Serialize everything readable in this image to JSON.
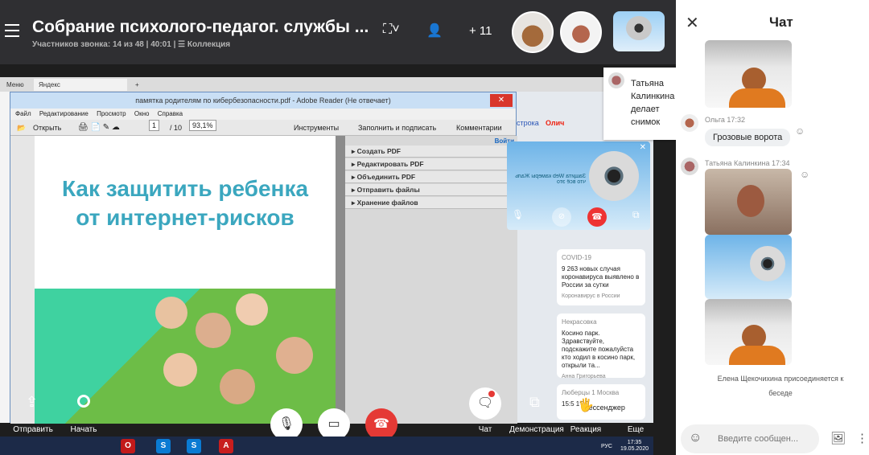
{
  "call": {
    "title": "Собрание психолого-педагог. службы ...",
    "subtitle": "Участников звонка: 14 из 48 | 40:01 | ☰ Коллекция",
    "extra_participants": "+ 11"
  },
  "browser": {
    "tabs": [
      {
        "label": "Меню"
      },
      {
        "label": "Яндекс"
      }
    ],
    "new_tab": "+"
  },
  "reader": {
    "title": "памятка родителям по кибербезопасности.pdf - Adobe Reader (Не отвечает)",
    "close": "✕",
    "menu": [
      "Файл",
      "Редактирование",
      "Просмотр",
      "Окно",
      "Справка"
    ],
    "toolbar": {
      "open": "Открыть",
      "page_current": "1",
      "page_total": "/ 10",
      "zoom": "93,1%",
      "tools": "Инструменты",
      "fill_sign": "Заполнить и подписать",
      "comments": "Комментарии"
    },
    "signin": "Войти",
    "panel_items": [
      "Создать PDF",
      "Редактировать PDF",
      "Объединить PDF",
      "Отправить файлы",
      "Хранение файлов"
    ],
    "doc_heading_line1": "Как защитить ребенка",
    "doc_heading_line2": "от интернет-рисков"
  },
  "yandex": {
    "astro": "строка",
    "olich": "Олич",
    "cards": [
      {
        "header": "COVID-19",
        "body": "9 263 новых случая коронавируса выявлено в России за сутки",
        "footer": "Коронавирус в России"
      },
      {
        "header": "Некрасовка",
        "body": "Косино парк. Здравствуйте, подскажите пожалуйста кто ходил в косино парк, открыли та...",
        "footer": "Анна Григорьева"
      },
      {
        "header": "Люберцы 1 Москва",
        "body": "15:5 15:5",
        "footer": ""
      }
    ],
    "messenger": "Мессенджер"
  },
  "selfview": {
    "caption": "Защита Web камеры Жаль что всё это"
  },
  "tooltip": {
    "text": "Татьяна Калинкина делает снимок"
  },
  "controls": {
    "share_link": "Отправить ссылку на вызов",
    "record": "Начать запись",
    "chat": "Чат",
    "screen_share": "Демонстрация экрана",
    "reaction": "Реакция",
    "more": "Еще"
  },
  "taskbar": {
    "tray_lang": "РУС",
    "time": "17:35",
    "date": "19.05.2020"
  },
  "chat": {
    "title": "Чат",
    "messages": [
      {
        "author_time": "Ольга 17:32",
        "text": "Грозовые ворота"
      },
      {
        "author_time": "Татьяна Калинкина 17:34"
      }
    ],
    "system_message": "Елена Щекочихина присоединяется к беседе",
    "input_placeholder": "Введите сообщен..."
  },
  "colors": {
    "header_bg": "#2f2f32",
    "end_call": "#e53935",
    "accent_teal": "#3ba7bf"
  }
}
